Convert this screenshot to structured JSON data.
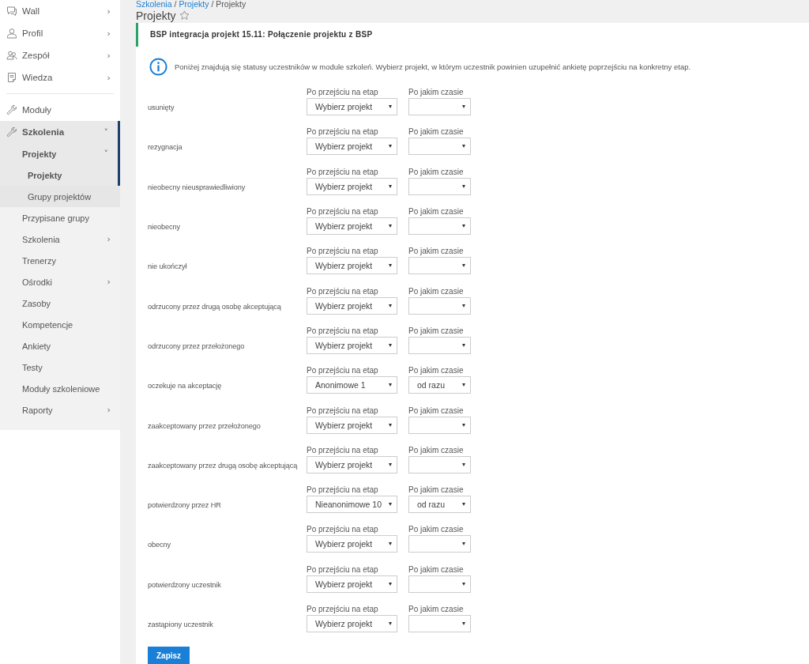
{
  "sidebar": {
    "sections": [
      [
        {
          "label": "Wall",
          "chevron": "›",
          "selected": false
        },
        {
          "label": "Profil",
          "chevron": "›",
          "selected": false
        },
        {
          "label": "Zespół",
          "chevron": "›",
          "selected": false
        },
        {
          "label": "Wiedza",
          "chevron": "›",
          "selected": false
        }
      ],
      [
        {
          "label": "Moduły",
          "selected": false
        },
        {
          "label": "Szkolenia",
          "chevron": "˅",
          "selected": true,
          "children": [
            {
              "label": "Projekty",
              "chevron": "˅",
              "selected": true,
              "children": [
                {
                  "label": "Projekty",
                  "selected": true
                },
                {
                  "label": "Grupy projektów",
                  "selected": false
                }
              ]
            },
            {
              "label": "Przypisane grupy",
              "selected": false
            },
            {
              "label": "Szkolenia",
              "chevron": "›",
              "selected": false
            },
            {
              "label": "Trenerzy",
              "selected": false
            },
            {
              "label": "Ośrodki",
              "chevron": "›",
              "selected": false
            },
            {
              "label": "Zasoby",
              "selected": false
            },
            {
              "label": "Kompetencje",
              "selected": false
            },
            {
              "label": "Ankiety",
              "selected": false
            },
            {
              "label": "Testy",
              "selected": false
            },
            {
              "label": "Moduły szkoleniowe",
              "selected": false
            },
            {
              "label": "Raporty",
              "chevron": "›",
              "selected": false
            }
          ]
        }
      ]
    ]
  },
  "breadcrumb": [
    {
      "label": "Szkolenia",
      "kind": "link"
    },
    {
      "label": "Projekty",
      "kind": "link"
    },
    {
      "label": "Projekty",
      "kind": "current"
    }
  ],
  "breadcrumb_separator": "/",
  "page_title": "Projekty",
  "favorite": false,
  "panel_title": "BSP integracja projekt 15.11: Połączenie projektu z BSP",
  "info_text": "Poniżej znajdują się statusy uczestników w module szkoleń. Wybierz projekt, w którym uczestnik powinien uzupełnić ankietę poprzejściu na konkretny etap.",
  "rows": [
    {
      "status": "usunięty",
      "stage_label": "Po przejściu na etap",
      "stage_value": "Wybierz projekt",
      "time_label": "Po jakim czasie",
      "time_value": ""
    },
    {
      "status": "rezygnacja",
      "stage_label": "Po przejściu na etap",
      "stage_value": "Wybierz projekt",
      "time_label": "Po jakim czasie",
      "time_value": ""
    },
    {
      "status": "nieobecny nieusprawiedliwiony",
      "stage_label": "Po przejściu na etap",
      "stage_value": "Wybierz projekt",
      "time_label": "Po jakim czasie",
      "time_value": ""
    },
    {
      "status": "nieobecny",
      "stage_label": "Po przejściu na etap",
      "stage_value": "Wybierz projekt",
      "time_label": "Po jakim czasie",
      "time_value": ""
    },
    {
      "status": "nie ukończył",
      "stage_label": "Po przejściu na etap",
      "stage_value": "Wybierz projekt",
      "time_label": "Po jakim czasie",
      "time_value": ""
    },
    {
      "status": "odrzucony przez drugą osobę akceptującą",
      "stage_label": "Po przejściu na etap",
      "stage_value": "Wybierz projekt",
      "time_label": "Po jakim czasie",
      "time_value": ""
    },
    {
      "status": "odrzucony przez przełożonego",
      "stage_label": "Po przejściu na etap",
      "stage_value": "Wybierz projekt",
      "time_label": "Po jakim czasie",
      "time_value": ""
    },
    {
      "status": "oczekuje na akceptację",
      "stage_label": "Po przejściu na etap",
      "stage_value": "Anonimowe 1",
      "time_label": "Po jakim czasie",
      "time_value": "od razu"
    },
    {
      "status": "zaakceptowany przez przełożonego",
      "stage_label": "Po przejściu na etap",
      "stage_value": "Wybierz projekt",
      "time_label": "Po jakim czasie",
      "time_value": ""
    },
    {
      "status": "zaakceptowany przez drugą osobę akceptującą",
      "stage_label": "Po przejściu na etap",
      "stage_value": "Wybierz projekt",
      "time_label": "Po jakim czasie",
      "time_value": ""
    },
    {
      "status": "potwierdzony przez HR",
      "stage_label": "Po przejściu na etap",
      "stage_value": "Nieanonimowe 10",
      "time_label": "Po jakim czasie",
      "time_value": "od razu"
    },
    {
      "status": "obecny",
      "stage_label": "Po przejściu na etap",
      "stage_value": "Wybierz projekt",
      "time_label": "Po jakim czasie",
      "time_value": ""
    },
    {
      "status": "potwierdzony uczestnik",
      "stage_label": "Po przejściu na etap",
      "stage_value": "Wybierz projekt",
      "time_label": "Po jakim czasie",
      "time_value": ""
    },
    {
      "status": "zastąpiony uczestnik",
      "stage_label": "Po przejściu na etap",
      "stage_value": "Wybierz projekt",
      "time_label": "Po jakim czasie",
      "time_value": ""
    }
  ],
  "save_button": "Zapisz"
}
